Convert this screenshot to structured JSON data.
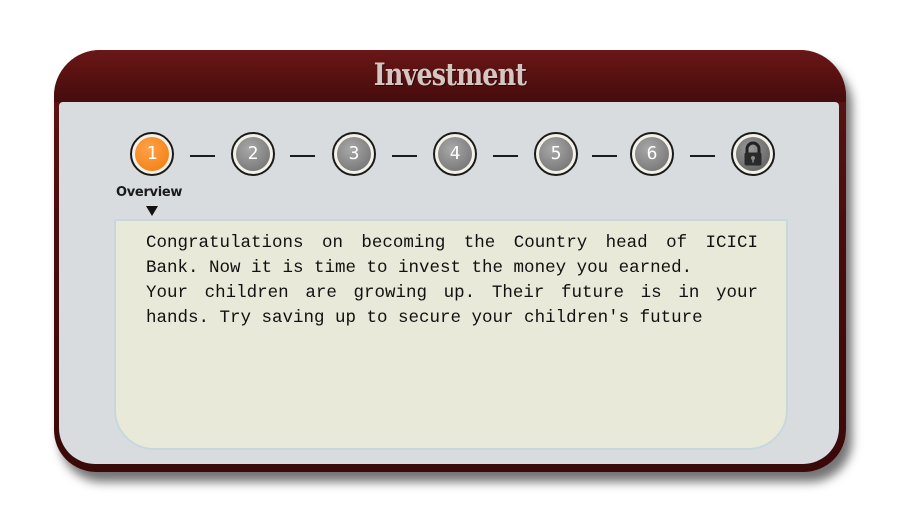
{
  "title": "Investment",
  "steps": [
    {
      "label": "1",
      "state": "active"
    },
    {
      "label": "2",
      "state": "inactive"
    },
    {
      "label": "3",
      "state": "inactive"
    },
    {
      "label": "4",
      "state": "inactive"
    },
    {
      "label": "5",
      "state": "inactive"
    },
    {
      "label": "6",
      "state": "inactive"
    },
    {
      "label": "",
      "state": "locked",
      "icon": "lock-icon"
    }
  ],
  "current_step_label": "Overview",
  "description": {
    "para1": "Congratulations on becoming the Country head of ICICI Bank. Now it is time to invest the money you earned.",
    "para2": "Your children are growing up. Their future is in your hands. Try saving up to secure your children's future"
  },
  "colors": {
    "frame": "#561010",
    "title_text": "#d6c6c1",
    "body_bg": "#d9dcdf",
    "active_step": "#f5861f",
    "inactive_step": "#7e7e7e",
    "text_box_bg": "#e9e9d9"
  }
}
